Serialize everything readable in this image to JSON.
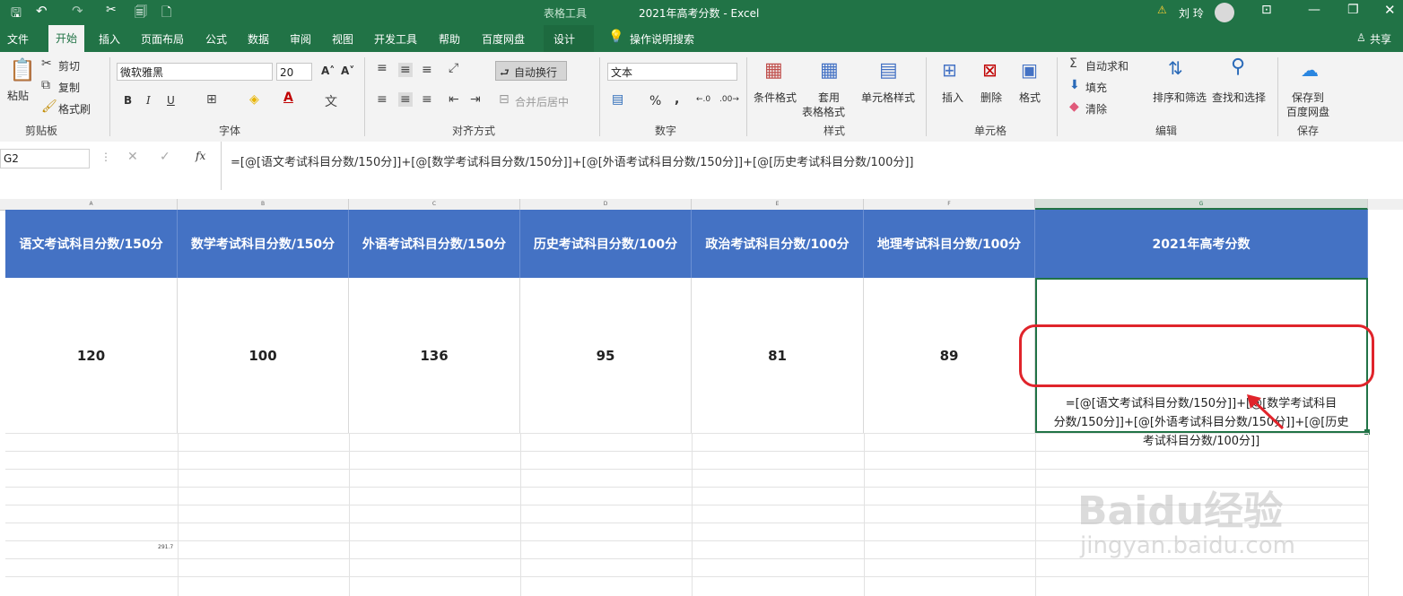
{
  "window": {
    "title": "2021年高考分数 - Excel",
    "context_tool": "表格工具",
    "user": "刘 玲"
  },
  "tabs": [
    "文件",
    "开始",
    "插入",
    "页面布局",
    "公式",
    "数据",
    "审阅",
    "视图",
    "开发工具",
    "帮助",
    "百度网盘",
    "设计"
  ],
  "tell_me": "操作说明搜索",
  "share": "共享",
  "ribbon": {
    "clipboard": {
      "paste": "粘贴",
      "cut": "剪切",
      "copy": "复制",
      "format_painter": "格式刷",
      "group": "剪贴板"
    },
    "font": {
      "name": "微软雅黑",
      "size": "20",
      "bold": "B",
      "italic": "I",
      "underline": "U",
      "group": "字体"
    },
    "alignment": {
      "wrap": "自动换行",
      "merge": "合并后居中",
      "group": "对齐方式"
    },
    "number": {
      "format": "文本",
      "percent": "%",
      "comma": ",",
      "group": "数字"
    },
    "styles": {
      "conditional": "条件格式",
      "table_format_1": "套用",
      "table_format_2": "表格格式",
      "cell_styles": "单元格样式",
      "group": "样式"
    },
    "cells": {
      "insert": "插入",
      "delete": "删除",
      "format": "格式",
      "group": "单元格"
    },
    "editing": {
      "autosum": "自动求和",
      "fill": "填充",
      "clear": "清除",
      "sort": "排序和筛选",
      "find": "查找和选择",
      "group": "编辑"
    },
    "save": {
      "line1": "保存到",
      "line2": "百度网盘",
      "group": "保存"
    }
  },
  "formula_bar": {
    "name_box": "G2",
    "fx": "fx",
    "formula": "=[@[语文考试科目分数/150分]]+[@[数学考试科目分数/150分]]+[@[外语考试科目分数/150分]]+[@[历史考试科目分数/100分]]"
  },
  "columns": [
    "A",
    "B",
    "C",
    "D",
    "E",
    "F",
    "G"
  ],
  "table": {
    "headers": [
      "语文考试科目分数/150分",
      "数学考试科目分数/150分",
      "外语考试科目分数/150分",
      "历史考试科目分数/100分",
      "政治考试科目分数/100分",
      "地理考试科目分数/100分",
      "2021年高考分数"
    ],
    "row": [
      "120",
      "100",
      "136",
      "95",
      "81",
      "89"
    ],
    "g2_lines": [
      "=[@[语文考试科目分数/150分]]+[@[数学考试科目",
      "分数/150分]]+[@[外语考试科目分数/150分]]+[@[历史",
      "考试科目分数/100分]]"
    ]
  },
  "stray_value": "291.7",
  "watermark": {
    "brand": "Baidu经验",
    "url": "jingyan.baidu.com"
  },
  "colors": {
    "excel_green": "#217346",
    "header_blue": "#4472c4",
    "highlight_red": "#e0242b"
  }
}
